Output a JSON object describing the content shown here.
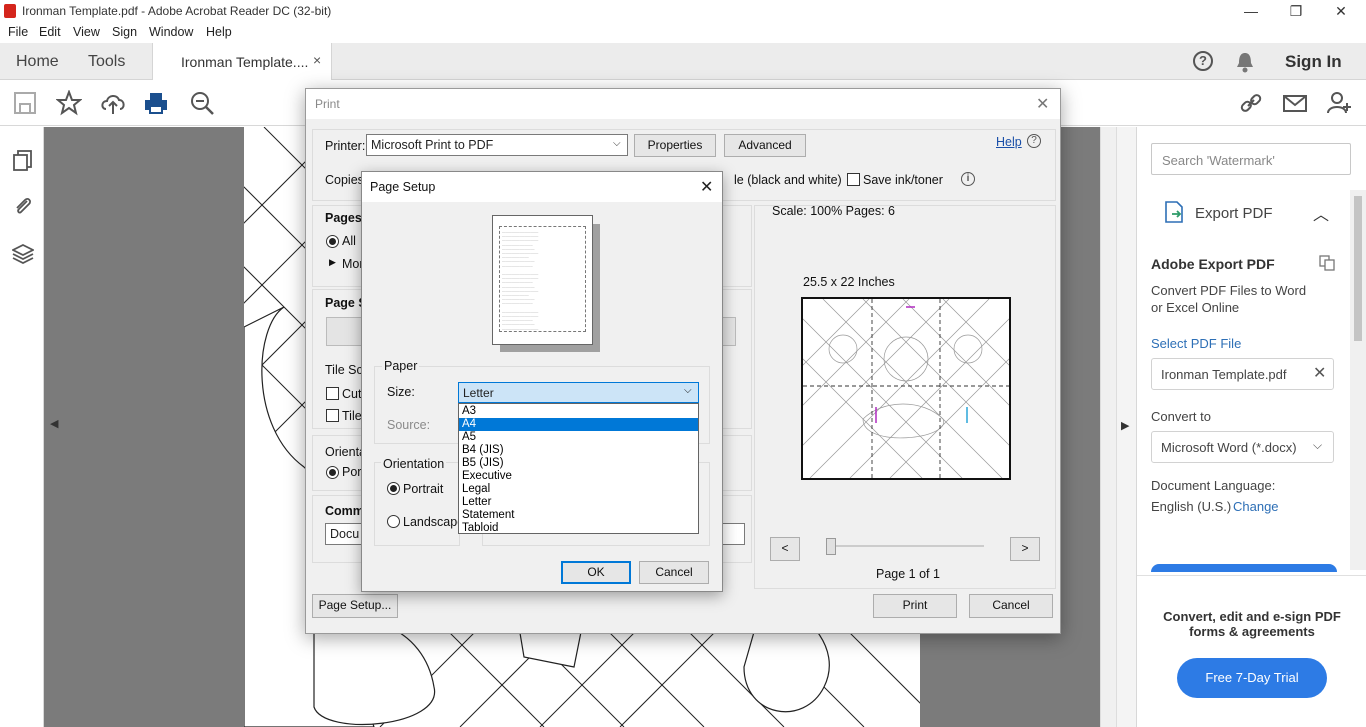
{
  "window": {
    "title": "Ironman Template.pdf - Adobe Acrobat Reader DC (32-bit)",
    "minimize": "—",
    "restore": "❐",
    "close": "✕"
  },
  "menu": [
    "File",
    "Edit",
    "View",
    "Sign",
    "Window",
    "Help"
  ],
  "tabs": {
    "home": "Home",
    "tools": "Tools",
    "document": "Ironman Template....",
    "close": "×"
  },
  "header_right": {
    "sign_in": "Sign In"
  },
  "right_panel": {
    "search_placeholder": "Search 'Watermark'",
    "export_title": "Export PDF",
    "adobe_export": "Adobe Export PDF",
    "convert_desc_1": "Convert PDF Files to Word",
    "convert_desc_2": "or Excel Online",
    "select_file": "Select PDF File",
    "file_name": "Ironman Template.pdf",
    "convert_to": "Convert to",
    "format": "Microsoft Word (*.docx)",
    "doc_language_label": "Document Language:",
    "doc_language": "English (U.S.)",
    "change": "Change",
    "promo_1": "Convert, edit and e-sign PDF",
    "promo_2": "forms & agreements",
    "trial": "Free 7-Day Trial"
  },
  "print_dialog": {
    "title": "Print",
    "printer_label": "Printer:",
    "printer": "Microsoft Print to PDF",
    "properties": "Properties",
    "advanced": "Advanced",
    "help": "Help",
    "copies_label": "Copies",
    "grayscale_tail": "le (black and white)",
    "save_ink": "Save ink/toner",
    "pages_label": "Pages t",
    "all": "All",
    "more": "Mor",
    "page_sizing": "Page S",
    "tile_scale": "Tile Sca",
    "cut": "Cut",
    "tile": "Tile",
    "orientation": "Orienta",
    "portrait_short": "Port",
    "comments": "Comm",
    "document_short": "Docu",
    "scale_pages": "Scale: 100% Pages: 6",
    "dimensions": "25.5 x 22 Inches",
    "prev": "<",
    "next": ">",
    "page_of": "Page 1 of 1",
    "page_setup_btn": "Page Setup...",
    "print_btn": "Print",
    "cancel_btn": "Cancel"
  },
  "page_setup": {
    "title": "Page Setup",
    "paper_group": "Paper",
    "size_label": "Size:",
    "size_value": "Letter",
    "source_label": "Source:",
    "orientation_group": "Orientation",
    "portrait": "Portrait",
    "landscape": "Landscape",
    "ok": "OK",
    "cancel": "Cancel",
    "size_options": [
      "A3",
      "A4",
      "A5",
      "B4 (JIS)",
      "B5 (JIS)",
      "Executive",
      "Legal",
      "Letter",
      "Statement",
      "Tabloid"
    ],
    "highlighted_option": "A4"
  }
}
